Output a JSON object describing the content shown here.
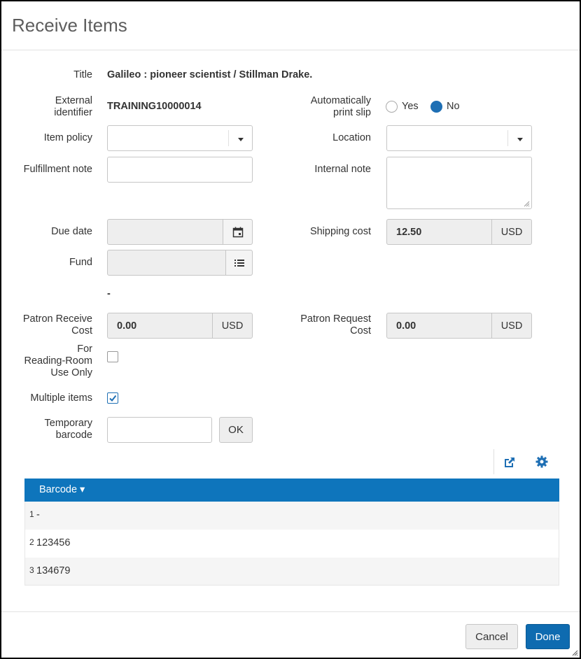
{
  "dialog": {
    "title": "Receive Items"
  },
  "form": {
    "title_label": "Title",
    "title_value": "Galileo : pioneer scientist / Stillman Drake.",
    "external_id_label_1": "External",
    "external_id_label_2": "identifier",
    "external_id_value": "TRAINING10000014",
    "auto_print_label_1": "Automatically",
    "auto_print_label_2": "print slip",
    "auto_print_yes": "Yes",
    "auto_print_no": "No",
    "auto_print_selected": "No",
    "item_policy_label": "Item policy",
    "item_policy_value": "",
    "location_label": "Location",
    "location_value": "",
    "fulfillment_note_label": "Fulfillment note",
    "fulfillment_note_value": "",
    "internal_note_label": "Internal note",
    "internal_note_value": "",
    "due_date_label": "Due date",
    "due_date_value": "",
    "shipping_cost_label": "Shipping cost",
    "shipping_cost_value": "12.50",
    "shipping_cost_currency": "USD",
    "fund_label": "Fund",
    "fund_value": "",
    "fund_note": "-",
    "patron_receive_cost_label_1": "Patron Receive",
    "patron_receive_cost_label_2": "Cost",
    "patron_receive_cost_value": "0.00",
    "patron_receive_cost_currency": "USD",
    "patron_request_cost_label_1": "Patron Request",
    "patron_request_cost_label_2": "Cost",
    "patron_request_cost_value": "0.00",
    "patron_request_cost_currency": "USD",
    "reading_room_label_1": "For",
    "reading_room_label_2": "Reading-Room",
    "reading_room_label_3": "Use Only",
    "reading_room_checked": false,
    "multiple_items_label": "Multiple items",
    "multiple_items_checked": true,
    "temp_barcode_label_1": "Temporary",
    "temp_barcode_label_2": "barcode",
    "temp_barcode_value": "",
    "ok_label": "OK"
  },
  "toolbar": {
    "export_icon": "external-link-icon",
    "settings_icon": "gear-icon"
  },
  "table": {
    "columns": [
      "Barcode"
    ],
    "sort_indicator": "▾",
    "rows": [
      {
        "index": "1",
        "barcode": "-"
      },
      {
        "index": "2",
        "barcode": "123456"
      },
      {
        "index": "3",
        "barcode": "134679"
      }
    ]
  },
  "footer": {
    "cancel_label": "Cancel",
    "done_label": "Done"
  },
  "colors": {
    "accent": "#0e75bc",
    "primary_button": "#0e6bb0",
    "radio_checked": "#1e6fb4"
  }
}
